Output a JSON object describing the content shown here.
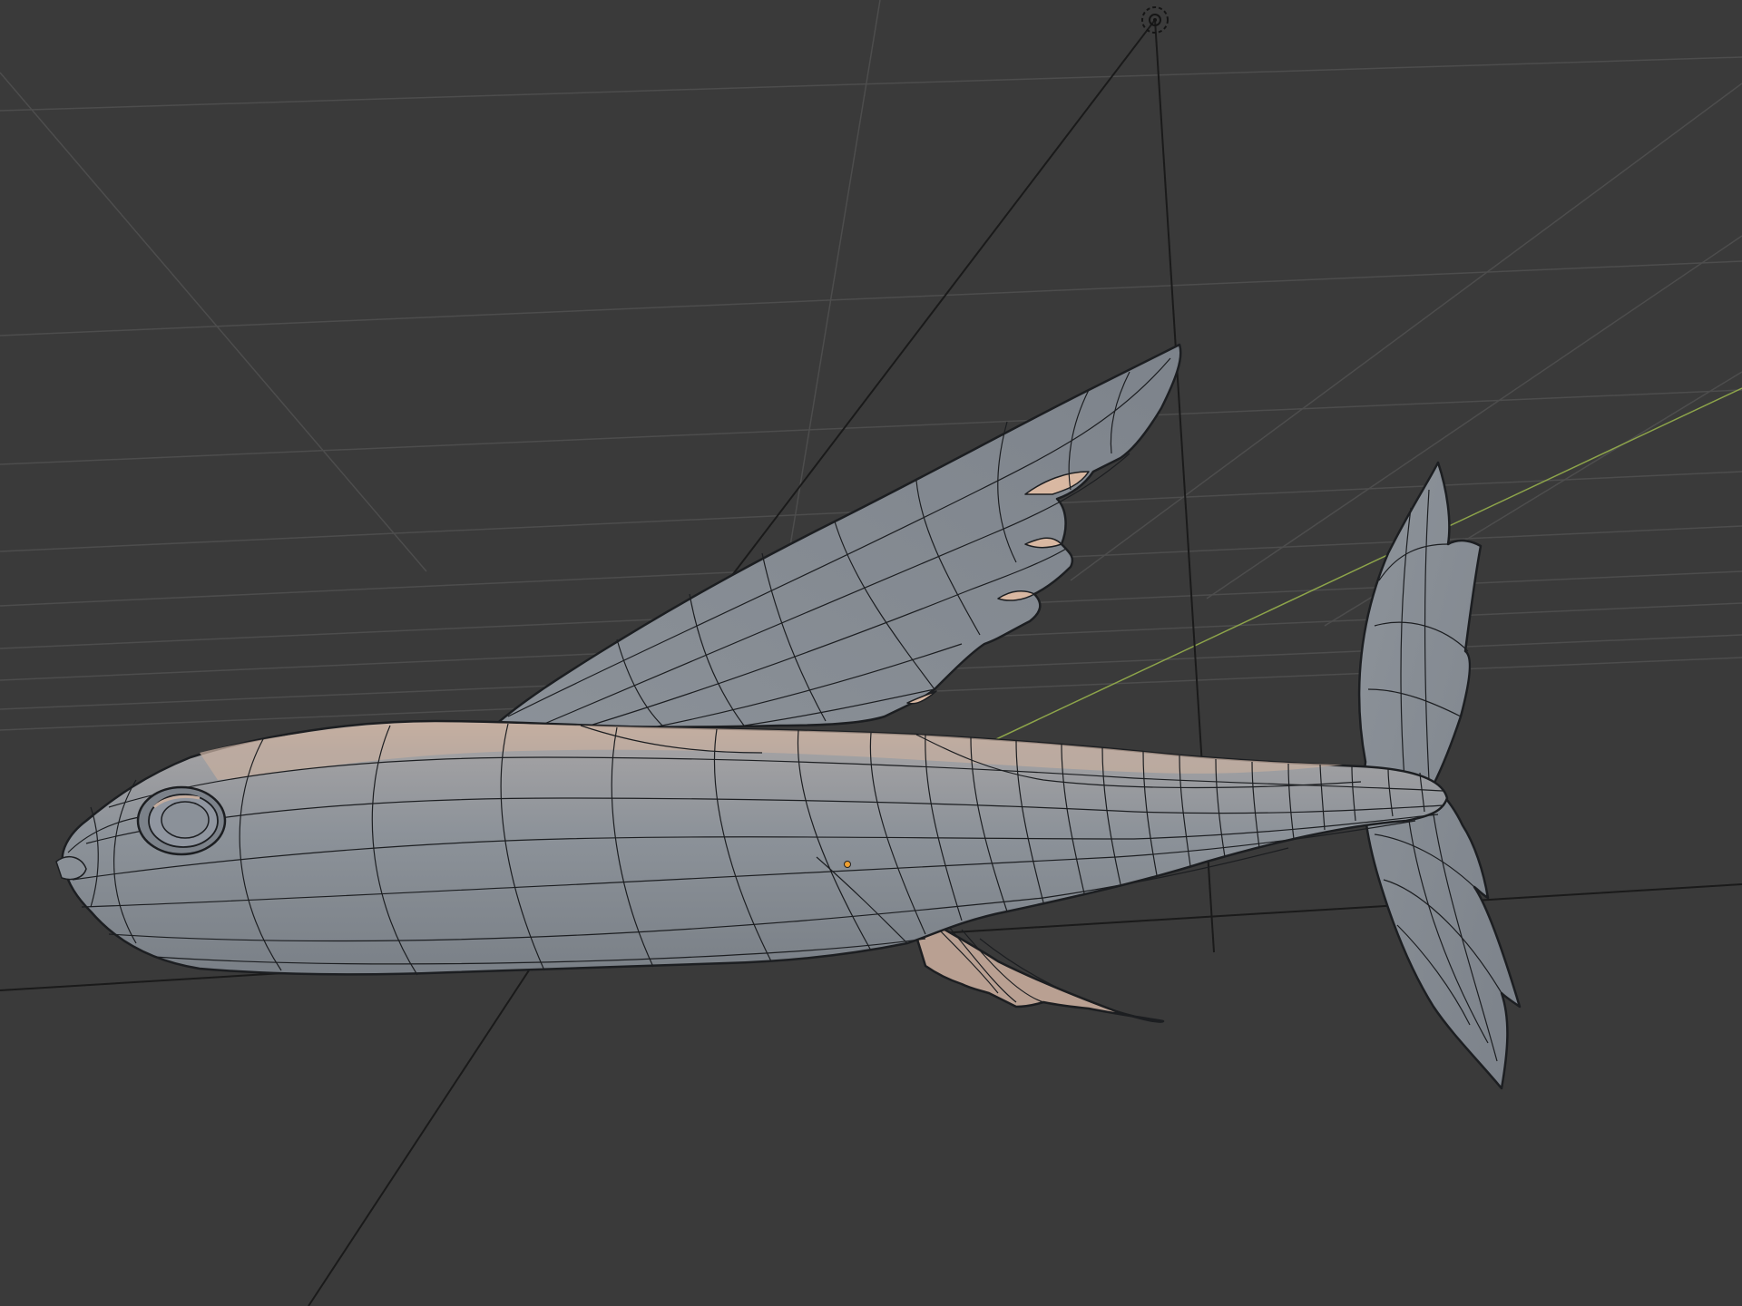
{
  "viewport": {
    "background_color": "#3a3a3a",
    "grid_color": "#4e4e4e",
    "y_axis_color": "#8da44a",
    "helper_line_color": "#1a1a1a",
    "mesh_fill_color": "#8a9097",
    "mesh_wire_color": "#1c1e21",
    "highlight_color": "#d9b8a2",
    "origin_color": "#f0a030"
  },
  "scene": {
    "object": "flying-fish-mesh",
    "light": "point-light-icon",
    "origin": "object-origin-icon"
  }
}
